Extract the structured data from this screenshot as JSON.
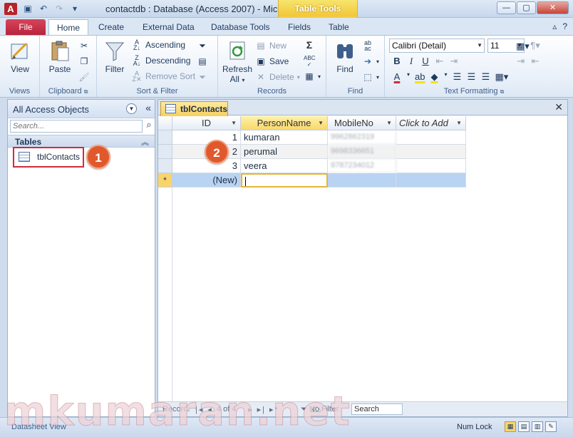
{
  "window": {
    "title": "contactdb : Database (Access 2007)  -  Mic...",
    "contextual_tab_group": "Table Tools",
    "app_icon_letter": "A"
  },
  "ribbon_tabs": [
    "File",
    "Home",
    "Create",
    "External Data",
    "Database Tools",
    "Fields",
    "Table"
  ],
  "ribbon": {
    "views": {
      "view": "View",
      "label": "Views"
    },
    "clipboard": {
      "paste": "Paste",
      "label": "Clipboard"
    },
    "sort_filter": {
      "filter": "Filter",
      "ascending": "Ascending",
      "descending": "Descending",
      "remove_sort": "Remove Sort",
      "label": "Sort & Filter"
    },
    "records": {
      "refresh": "Refresh",
      "refresh_all": "All",
      "new": "New",
      "save": "Save",
      "delete": "Delete",
      "label": "Records"
    },
    "find": {
      "find": "Find",
      "label": "Find"
    },
    "text_formatting": {
      "font": "Calibri (Detail)",
      "size": "11",
      "label": "Text Formatting"
    }
  },
  "nav_pane": {
    "title": "All Access Objects",
    "search_placeholder": "Search...",
    "group": "Tables",
    "items": [
      {
        "label": "tblContacts"
      }
    ]
  },
  "badges": {
    "one": "1",
    "two": "2"
  },
  "document": {
    "tab": "tblContacts",
    "columns": [
      "ID",
      "PersonName",
      "MobileNo",
      "Click to Add"
    ],
    "rows": [
      {
        "id": "1",
        "name": "kumaran",
        "mobile": "9962862319"
      },
      {
        "id": "2",
        "name": "perumal",
        "mobile": "9698336651"
      },
      {
        "id": "3",
        "name": "veera",
        "mobile": "9787234012"
      }
    ],
    "new_row": "(New)",
    "new_row_marker": "*"
  },
  "record_nav": {
    "label": "Record:",
    "position": "4 of 4",
    "filter": "No Filter",
    "search": "Search"
  },
  "status": {
    "view": "Datasheet View",
    "num_lock": "Num Lock"
  },
  "watermark": "mkumaran.net"
}
